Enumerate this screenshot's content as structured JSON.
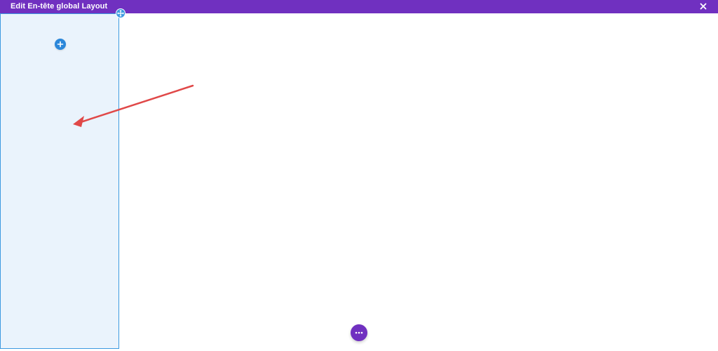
{
  "header": {
    "title": "Edit En-tête global Layout",
    "close_icon": "close-icon",
    "background_color": "#7030c0"
  },
  "builder": {
    "column": {
      "settings_icon": "move-icon",
      "add_module_icon": "plus-icon",
      "border_color": "#3d9ae0",
      "fill_color": "#eaf3fc"
    },
    "annotation": {
      "arrow_color": "#e04848"
    },
    "more_button": {
      "icon": "ellipsis-icon",
      "color": "#7030c0"
    }
  }
}
